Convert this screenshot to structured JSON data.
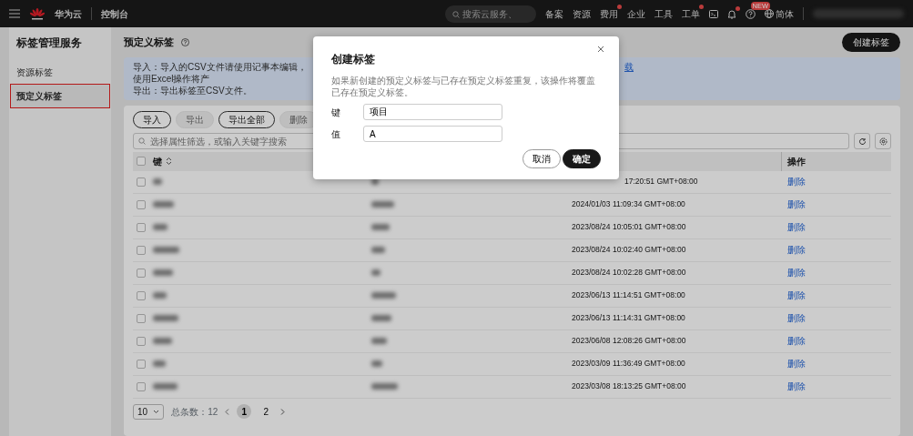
{
  "topbar": {
    "brand": "华为云",
    "section": "控制台",
    "search": {
      "placeholder": "搜索云服务、"
    },
    "links": [
      {
        "label": "备案",
        "dot": false
      },
      {
        "label": "资源",
        "dot": false
      },
      {
        "label": "费用",
        "dot": true
      },
      {
        "label": "企业",
        "dot": false
      },
      {
        "label": "工具",
        "dot": false
      },
      {
        "label": "工单",
        "dot": true
      }
    ],
    "bell_dot": true,
    "help_badge": "NEW",
    "language": "简体"
  },
  "sidebar": {
    "title": "标签管理服务",
    "items": [
      {
        "label": "资源标签",
        "selected": false
      },
      {
        "label": "预定义标签",
        "selected": true
      }
    ]
  },
  "page": {
    "title": "预定义标签",
    "create_button": "创建标签",
    "notice": {
      "line_1": "导入：导入的CSV文件请使用记事本编辑，使用Excel操作将产",
      "link": "载",
      "line_2": "导出：导出标签至CSV文件。"
    },
    "toolbar": [
      {
        "label": "导入",
        "disabled": false
      },
      {
        "label": "导出",
        "disabled": true
      },
      {
        "label": "导出全部",
        "disabled": false
      },
      {
        "label": "删除",
        "disabled": true
      }
    ],
    "search": {
      "placeholder": "选择属性筛选，或输入关键字搜索"
    },
    "table": {
      "columns": [
        "键",
        "操作"
      ],
      "select_all": {
        "checked": false
      },
      "rows": [
        {
          "checked": false,
          "time": "17:20:51 GMT+08:00",
          "action": "删除"
        },
        {
          "checked": false,
          "time": "2024/01/03 11:09:34 GMT+08:00",
          "action": "删除"
        },
        {
          "checked": false,
          "time": "2023/08/24 10:05:01 GMT+08:00",
          "action": "删除"
        },
        {
          "checked": false,
          "time": "2023/08/24 10:02:40 GMT+08:00",
          "action": "删除"
        },
        {
          "checked": false,
          "time": "2023/08/24 10:02:28 GMT+08:00",
          "action": "删除"
        },
        {
          "checked": false,
          "time": "2023/06/13 11:14:51 GMT+08:00",
          "action": "删除"
        },
        {
          "checked": false,
          "time": "2023/06/13 11:14:31 GMT+08:00",
          "action": "删除"
        },
        {
          "checked": false,
          "time": "2023/06/08 12:08:26 GMT+08:00",
          "action": "删除"
        },
        {
          "checked": false,
          "time": "2023/03/09 11:36:49 GMT+08:00",
          "action": "删除"
        },
        {
          "checked": false,
          "time": "2023/03/08 18:13:25 GMT+08:00",
          "action": "删除"
        }
      ]
    },
    "pagination": {
      "page_size": "10",
      "total": "总条数：12",
      "pages": [
        {
          "label": "1",
          "selected": true
        },
        {
          "label": "2",
          "selected": false
        }
      ]
    }
  },
  "dialog": {
    "title": "创建标签",
    "note": "如果新创建的预定义标签与已存在预定义标签重复，该操作将覆盖已存在预定义标签。",
    "fields": [
      {
        "label": "键",
        "value": "项目"
      },
      {
        "label": "值",
        "value": "A"
      }
    ],
    "buttons": [
      {
        "label": "取消",
        "kind": "secondary"
      },
      {
        "label": "确定",
        "kind": "primary"
      }
    ]
  }
}
